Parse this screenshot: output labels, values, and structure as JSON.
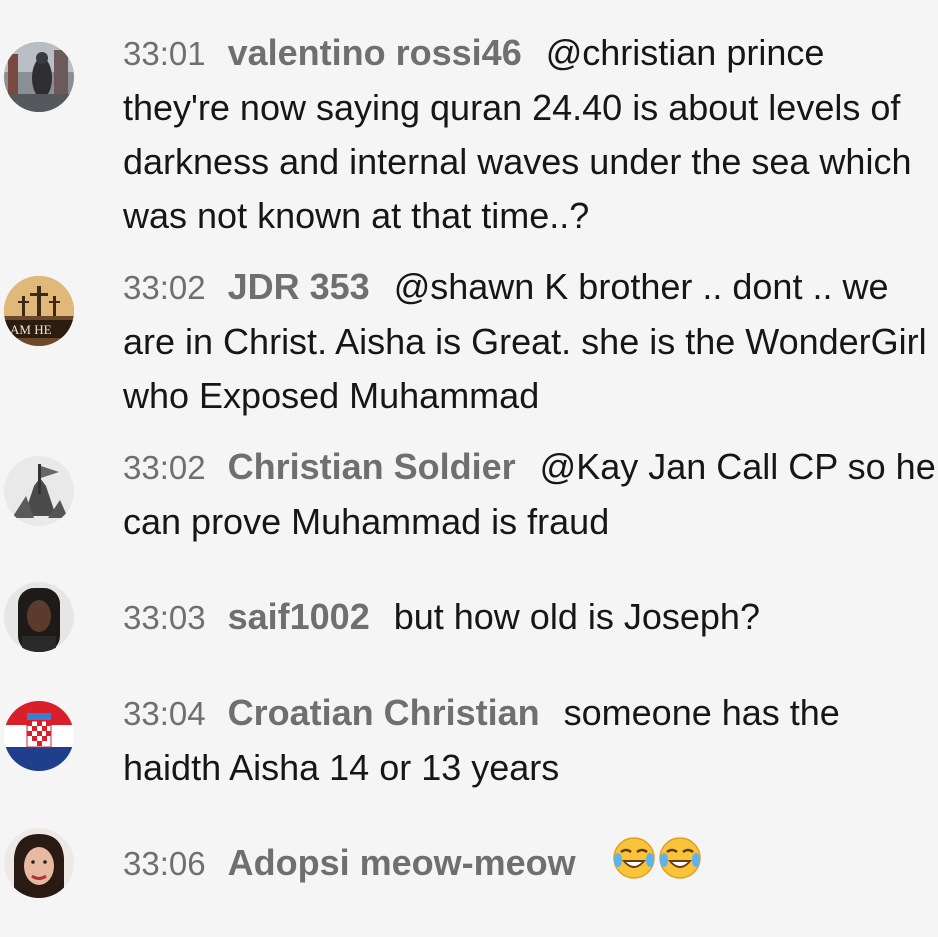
{
  "messages": [
    {
      "time": "33:01",
      "author": "valentino rossi46",
      "text": "@christian prince they're now saying quran 24.40 is about levels of darkness and internal waves under the sea which was not known at that time..?"
    },
    {
      "time": "33:02",
      "author": "JDR 353",
      "text": "@shawn K brother .. dont .. we are in Christ. Aisha is Great. she is the WonderGirl who Exposed Muhammad",
      "avatar_text": "AM HE"
    },
    {
      "time": "33:02",
      "author": "Christian Soldier",
      "text": "@Kay Jan Call CP so he can prove Muhammad is fraud"
    },
    {
      "time": "33:03",
      "author": "saif1002",
      "text": "but how old is Joseph?"
    },
    {
      "time": "33:04",
      "author": "Croatian Christian",
      "text": "someone has the haidth Aisha 14 or 13 years"
    },
    {
      "time": "33:06",
      "author": "Adopsi meow-meow",
      "text": "",
      "emojis": [
        "laughing-with-tears-emoji",
        "laughing-with-tears-emoji"
      ]
    }
  ]
}
